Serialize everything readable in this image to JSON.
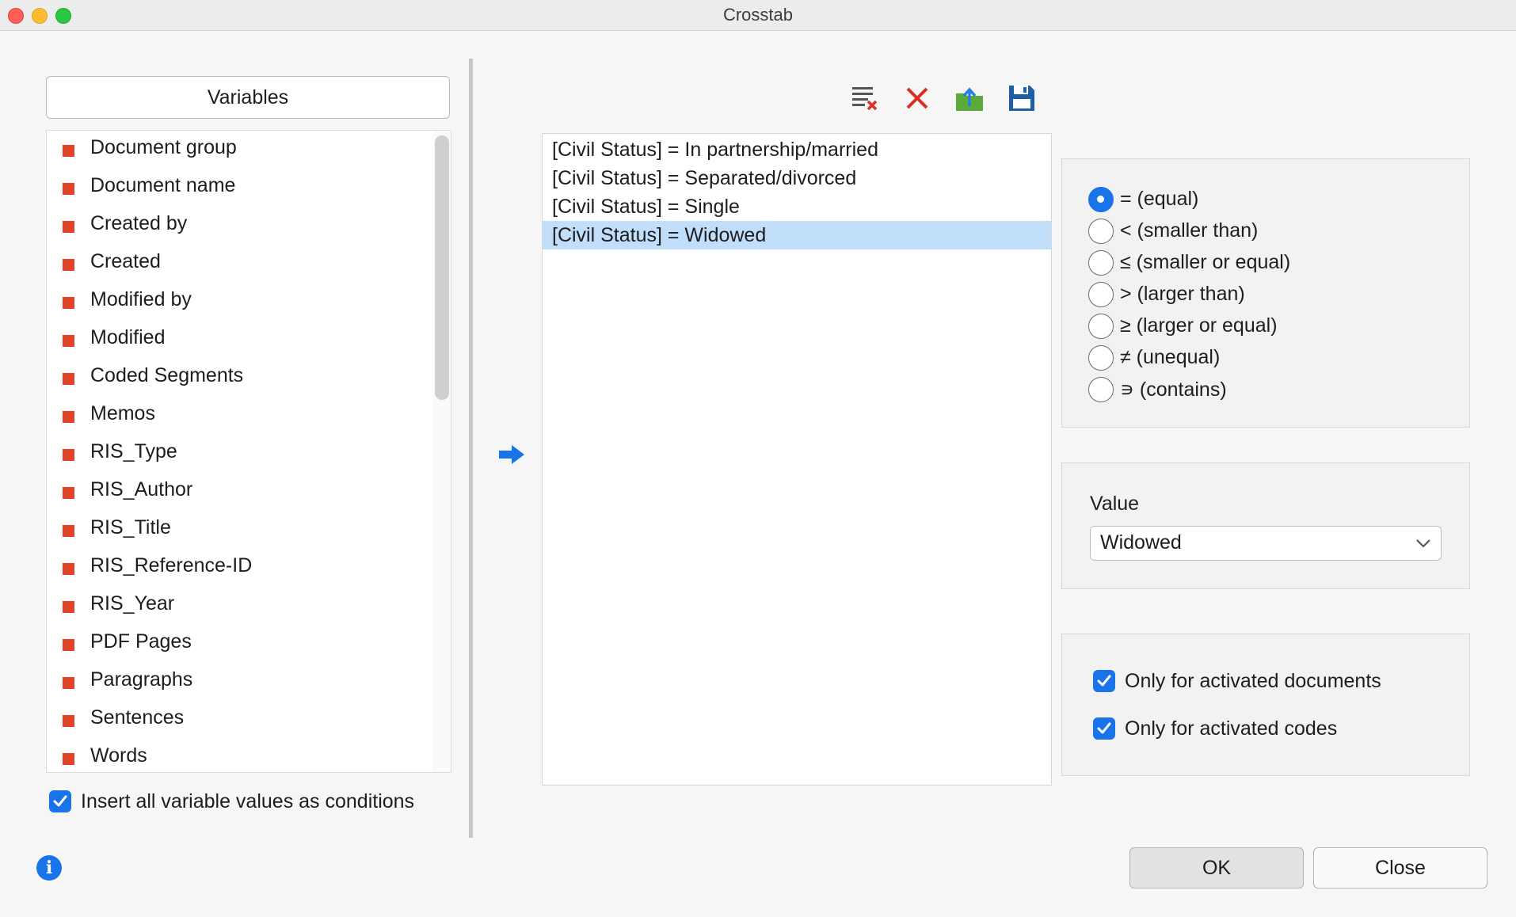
{
  "window": {
    "title": "Crosstab"
  },
  "variables": {
    "header": "Variables",
    "items": [
      "Document group",
      "Document name",
      "Created by",
      "Created",
      "Modified by",
      "Modified",
      "Coded Segments",
      "Memos",
      "RIS_Type",
      "RIS_Author",
      "RIS_Title",
      "RIS_Reference-ID",
      "RIS_Year",
      "PDF Pages",
      "Paragraphs",
      "Sentences",
      "Words"
    ],
    "insert_all_label": "Insert all variable values as conditions",
    "insert_all_checked": true
  },
  "toolbar": {
    "icons": [
      "clear-list-icon",
      "delete-icon",
      "export-icon",
      "save-icon"
    ]
  },
  "conditions": {
    "items": [
      "[Civil Status] = In partnership/married",
      "[Civil Status] = Separated/divorced",
      "[Civil Status] = Single",
      "[Civil Status] = Widowed"
    ],
    "selected_index": 3
  },
  "operators": {
    "options": [
      "= (equal)",
      "< (smaller than)",
      "≤ (smaller or equal)",
      "> (larger than)",
      "≥ (larger or equal)",
      "≠ (unequal)",
      "∍ (contains)"
    ],
    "selected_index": 0
  },
  "value": {
    "label": "Value",
    "selected": "Widowed"
  },
  "options": {
    "activated_documents_label": "Only for activated documents",
    "activated_documents_checked": true,
    "activated_codes_label": "Only for activated codes",
    "activated_codes_checked": true
  },
  "buttons": {
    "ok": "OK",
    "close": "Close"
  },
  "colors": {
    "accent": "#1a73e8",
    "variable_marker": "#e0452a",
    "selection": "#c1defb"
  }
}
